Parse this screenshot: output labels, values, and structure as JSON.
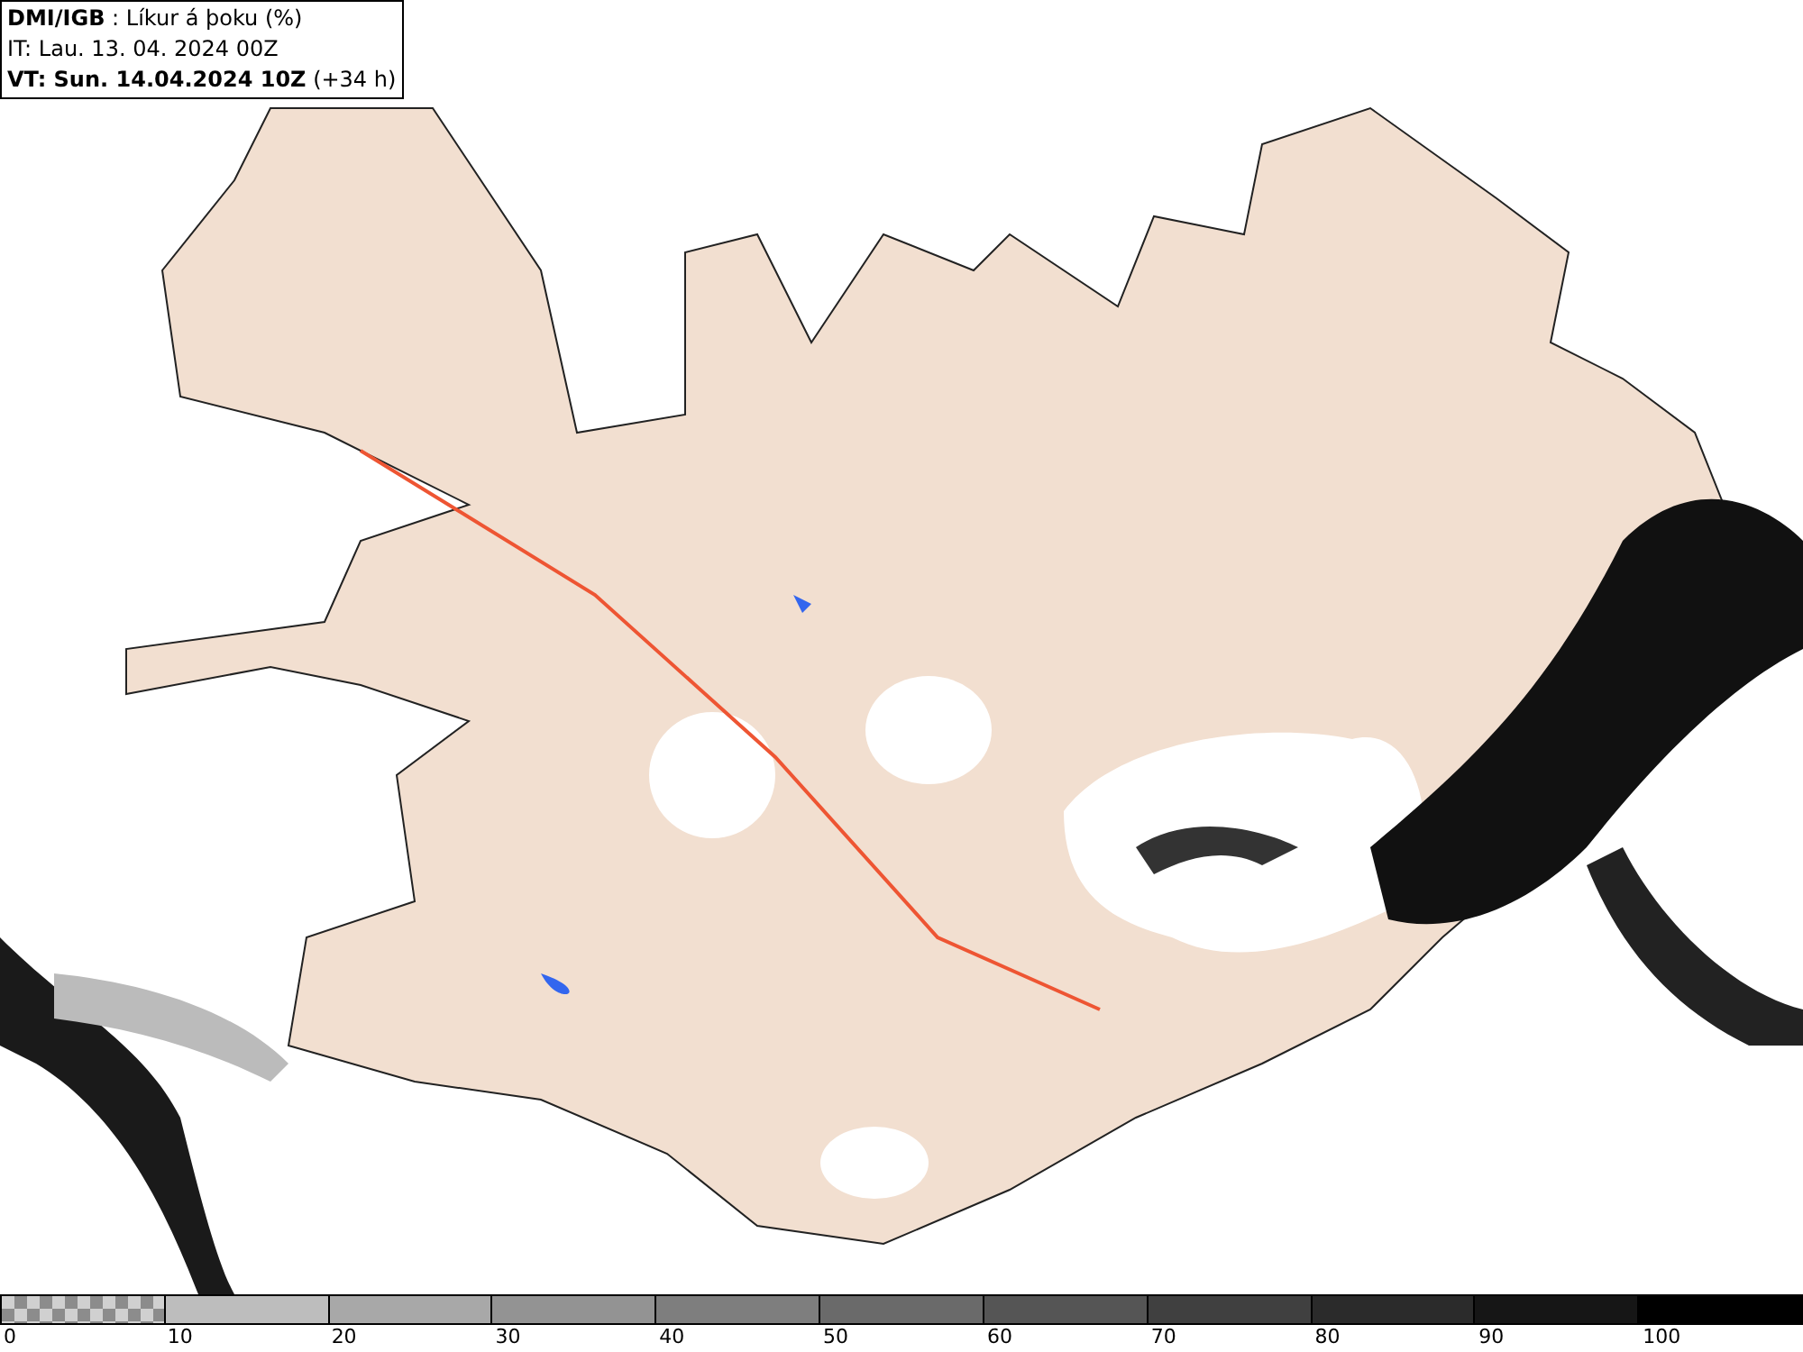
{
  "header": {
    "source": "DMI/IGB",
    "product": " : Líkur á þoku (%)",
    "init": "IT: Lau. 13. 04. 2024 00Z",
    "valid": "VT: Sun. 14.04.2024 10Z",
    "offset": " (+34 h)"
  },
  "legend": {
    "segments": [
      {
        "kind": "checker",
        "color": "#8c8c8c"
      },
      {
        "kind": "solid",
        "color": "#bdbdbd"
      },
      {
        "kind": "solid",
        "color": "#a8a8a8"
      },
      {
        "kind": "solid",
        "color": "#939393"
      },
      {
        "kind": "solid",
        "color": "#7e7e7e"
      },
      {
        "kind": "solid",
        "color": "#6a6a6a"
      },
      {
        "kind": "solid",
        "color": "#555555"
      },
      {
        "kind": "solid",
        "color": "#404040"
      },
      {
        "kind": "solid",
        "color": "#2b2b2b"
      },
      {
        "kind": "solid",
        "color": "#161616"
      },
      {
        "kind": "solid",
        "color": "#000000"
      }
    ],
    "ticks": [
      "0",
      "10",
      "20",
      "30",
      "40",
      "50",
      "60",
      "70",
      "80",
      "90",
      "100"
    ]
  }
}
